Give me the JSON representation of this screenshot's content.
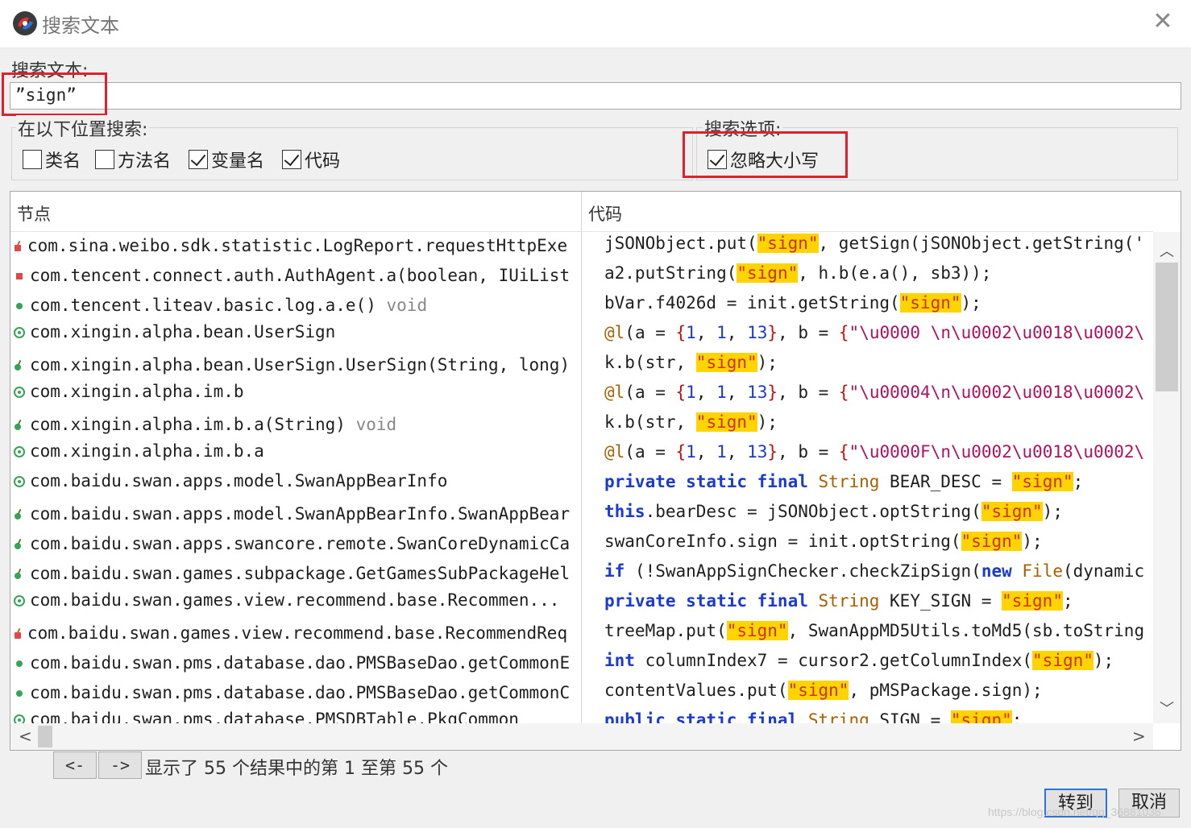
{
  "window": {
    "title": "搜索文本",
    "icons": {
      "app": "jadx-logo-icon",
      "close": "close-icon"
    }
  },
  "search": {
    "label": "搜索文本:",
    "value": "”sign”"
  },
  "search_in": {
    "title": "在以下位置搜索:",
    "options": [
      {
        "label": "类名",
        "checked": false
      },
      {
        "label": "方法名",
        "checked": false
      },
      {
        "label": "变量名",
        "checked": true
      },
      {
        "label": "代码",
        "checked": true
      }
    ]
  },
  "search_options": {
    "title": "搜索选项:",
    "ignore_case": {
      "label": "忽略大小写",
      "checked": true
    }
  },
  "results": {
    "col_node": "节点",
    "col_code": "代码",
    "nodes": [
      {
        "icon": "method-private",
        "text": "com.sina.weibo.sdk.statistic.LogReport.requestHttpExe",
        "suffix": ""
      },
      {
        "icon": "field-private",
        "text": "com.tencent.connect.auth.AuthAgent.a(boolean, IUiList",
        "suffix": ""
      },
      {
        "icon": "method-public",
        "text": "com.tencent.liteav.basic.log.a.e()",
        "suffix": " void"
      },
      {
        "icon": "class",
        "text": "com.xingin.alpha.bean.UserSign",
        "suffix": ""
      },
      {
        "icon": "method-constructor",
        "text": "com.xingin.alpha.bean.UserSign.UserSign(String, long)",
        "suffix": ""
      },
      {
        "icon": "class",
        "text": "com.xingin.alpha.im.b",
        "suffix": ""
      },
      {
        "icon": "method-constructor",
        "text": "com.xingin.alpha.im.b.a(String)",
        "suffix": " void"
      },
      {
        "icon": "class",
        "text": "com.xingin.alpha.im.b.a",
        "suffix": ""
      },
      {
        "icon": "class",
        "text": "com.baidu.swan.apps.model.SwanAppBearInfo",
        "suffix": ""
      },
      {
        "icon": "method-constructor",
        "text": "com.baidu.swan.apps.model.SwanAppBearInfo.SwanAppBear",
        "suffix": ""
      },
      {
        "icon": "method-constructor",
        "text": "com.baidu.swan.apps.swancore.remote.SwanCoreDynamicCa",
        "suffix": ""
      },
      {
        "icon": "method-constructor",
        "text": "com.baidu.swan.games.subpackage.GetGamesSubPackageHel",
        "suffix": ""
      },
      {
        "icon": "class",
        "text": "com.baidu.swan.games.view.recommend.base.Recommen...",
        "suffix": ""
      },
      {
        "icon": "method-private",
        "text": "com.baidu.swan.games.view.recommend.base.RecommendReq",
        "suffix": ""
      },
      {
        "icon": "method-public",
        "text": "com.baidu.swan.pms.database.dao.PMSBaseDao.getCommonE",
        "suffix": ""
      },
      {
        "icon": "method-public",
        "text": "com.baidu.swan.pms.database.dao.PMSBaseDao.getCommonC",
        "suffix": ""
      },
      {
        "icon": "class",
        "text": "com.baidu.swan.pms.database.PMSDBTable.PkgCommon",
        "suffix": ""
      }
    ],
    "code": [
      [
        [
          "t",
          "jSONObject.put("
        ],
        [
          "h",
          "\"sign\""
        ],
        [
          "t",
          ", getSign(jSONObject.getString('"
        ]
      ],
      [
        [
          "t",
          "a2.putString("
        ],
        [
          "h",
          "\"sign\""
        ],
        [
          "t",
          ", h.b(e.a(), sb3));"
        ]
      ],
      [
        [
          "t",
          "bVar.f4026d = init.getString("
        ],
        [
          "h",
          "\"sign\""
        ],
        [
          "t",
          ");"
        ]
      ],
      [
        [
          "ty",
          "@l"
        ],
        [
          "t",
          "(a = "
        ],
        [
          "br",
          "{"
        ],
        [
          "n",
          "1"
        ],
        [
          "t",
          ", "
        ],
        [
          "n",
          "1"
        ],
        [
          "t",
          ", "
        ],
        [
          "n",
          "13"
        ],
        [
          "br",
          "}"
        ],
        [
          "t",
          ", b = "
        ],
        [
          "br",
          "{"
        ],
        [
          "s",
          "\"\\u0000 \\n\\u0002\\u0018\\u0002\\"
        ]
      ],
      [
        [
          "t",
          "k.b(str, "
        ],
        [
          "h",
          "\"sign\""
        ],
        [
          "t",
          ");"
        ]
      ],
      [
        [
          "ty",
          "@l"
        ],
        [
          "t",
          "(a = "
        ],
        [
          "br",
          "{"
        ],
        [
          "n",
          "1"
        ],
        [
          "t",
          ", "
        ],
        [
          "n",
          "1"
        ],
        [
          "t",
          ", "
        ],
        [
          "n",
          "13"
        ],
        [
          "br",
          "}"
        ],
        [
          "t",
          ", b = "
        ],
        [
          "br",
          "{"
        ],
        [
          "s",
          "\"\\u00004\\n\\u0002\\u0018\\u0002\\"
        ]
      ],
      [
        [
          "t",
          "k.b(str, "
        ],
        [
          "h",
          "\"sign\""
        ],
        [
          "t",
          ");"
        ]
      ],
      [
        [
          "ty",
          "@l"
        ],
        [
          "t",
          "(a = "
        ],
        [
          "br",
          "{"
        ],
        [
          "n",
          "1"
        ],
        [
          "t",
          ", "
        ],
        [
          "n",
          "1"
        ],
        [
          "t",
          ", "
        ],
        [
          "n",
          "13"
        ],
        [
          "br",
          "}"
        ],
        [
          "t",
          ", b = "
        ],
        [
          "br",
          "{"
        ],
        [
          "s",
          "\"\\u0000F\\n\\u0002\\u0018\\u0002\\"
        ]
      ],
      [
        [
          "k",
          "private static final"
        ],
        [
          "t",
          " "
        ],
        [
          "ty",
          "String"
        ],
        [
          "t",
          " BEAR_DESC = "
        ],
        [
          "h",
          "\"sign\""
        ],
        [
          "t",
          ";"
        ]
      ],
      [
        [
          "k",
          "this"
        ],
        [
          "t",
          ".bearDesc = jSONObject.optString("
        ],
        [
          "h",
          "\"sign\""
        ],
        [
          "t",
          ");"
        ]
      ],
      [
        [
          "t",
          "swanCoreInfo.sign = init.optString("
        ],
        [
          "h",
          "\"sign\""
        ],
        [
          "t",
          ");"
        ]
      ],
      [
        [
          "k",
          "if"
        ],
        [
          "t",
          " (!SwanAppSignChecker.checkZipSign("
        ],
        [
          "k",
          "new"
        ],
        [
          "t",
          " "
        ],
        [
          "ty",
          "File"
        ],
        [
          "t",
          "(dynamic"
        ]
      ],
      [
        [
          "k",
          "private static final"
        ],
        [
          "t",
          " "
        ],
        [
          "ty",
          "String"
        ],
        [
          "t",
          " KEY_SIGN = "
        ],
        [
          "h",
          "\"sign\""
        ],
        [
          "t",
          ";"
        ]
      ],
      [
        [
          "t",
          "treeMap.put("
        ],
        [
          "h",
          "\"sign\""
        ],
        [
          "t",
          ", SwanAppMD5Utils.toMd5(sb.toString"
        ]
      ],
      [
        [
          "k",
          "int"
        ],
        [
          "t",
          " columnIndex7 = cursor2.getColumnIndex("
        ],
        [
          "h",
          "\"sign\""
        ],
        [
          "t",
          ");"
        ]
      ],
      [
        [
          "t",
          "contentValues.put("
        ],
        [
          "h",
          "\"sign\""
        ],
        [
          "t",
          ", pMSPackage.sign);"
        ]
      ],
      [
        [
          "k",
          "public static final"
        ],
        [
          "t",
          " "
        ],
        [
          "ty",
          "String"
        ],
        [
          "t",
          " SIGN = "
        ],
        [
          "h",
          "\"sign\""
        ],
        [
          "t",
          ";"
        ]
      ]
    ]
  },
  "nav": {
    "prev": "<-",
    "next": "->"
  },
  "status": "显示了 55 个结果中的第 1 至第 55 个",
  "buttons": {
    "goto": "转到",
    "cancel": "取消"
  },
  "watermark": "https://blog.csdn.net/qq_36881036",
  "colors": {
    "highlight_bg": "#ffd400",
    "highlight_fg": "#d03010",
    "keyword": "#1a3ad0",
    "annotation_box": "#e0202c"
  }
}
